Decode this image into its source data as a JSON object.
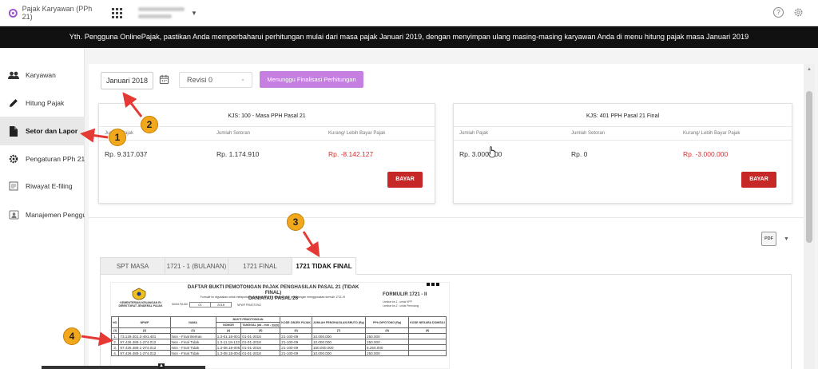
{
  "app": {
    "title": "Pajak Karyawan (PPh 21)"
  },
  "banner": {
    "text": "Yth. Pengguna OnlinePajak, pastikan Anda memperbaharui perhitungan mulai dari masa pajak Januari 2019, dengan menyimpan ulang masing-masing karyawan Anda di menu hitung pajak masa Januari 2019"
  },
  "sidebar": {
    "items": [
      {
        "label": "Karyawan",
        "icon": "people-icon"
      },
      {
        "label": "Hitung Pajak",
        "icon": "pencil-icon"
      },
      {
        "label": "Setor dan Lapor",
        "icon": "document-icon"
      },
      {
        "label": "Pengaturan PPh 21",
        "icon": "gear-icon"
      },
      {
        "label": "Riwayat E-filing",
        "icon": "history-icon"
      },
      {
        "label": "Manajemen Pengguna",
        "icon": "users-icon"
      }
    ]
  },
  "toolbar": {
    "month": "Januari 2018",
    "revision": "Revisi 0",
    "status_button": "Menunggu Finalisasi Perhitungan"
  },
  "cards": [
    {
      "title": "KJS: 100 - Masa PPH Pasal 21",
      "col1": "Jumlah Pajak",
      "col2": "Jumlah Setoran",
      "col3": "Kurang/ Lebih Bayar Pajak",
      "val1": "Rp. 9.317.037",
      "val2": "Rp. 1.174.910",
      "val3": "Rp. -8.142.127",
      "button": "BAYAR"
    },
    {
      "title": "KJS: 401 PPH Pasal 21 Final",
      "col1": "Jumlah Pajak",
      "col2": "Jumlah Setoran",
      "col3": "Kurang/ Lebih Bayar Pajak",
      "val1": "Rp. 3.000.000",
      "val2": "Rp. 0",
      "val3": "Rp. -3.000.000",
      "button": "BAYAR"
    }
  ],
  "export": {
    "label": "PDF"
  },
  "tabs": [
    {
      "label": "SPT MASA"
    },
    {
      "label": "1721 - 1 (BULANAN)"
    },
    {
      "label": "1721 FINAL"
    },
    {
      "label": "1721 TIDAK FINAL"
    }
  ],
  "document": {
    "agency": "KEMENTERIAN KEUANGAN RI DIREKTORAT JENDERAL PAJAK",
    "title_line1": "DAFTAR BUKTI PEMOTONGAN PAJAK PENGHASILAN PASAL 21 (TIDAK FINAL)",
    "title_line2": "DAN/ATAU PASAL 26",
    "subtitle": "Formulir ini digunakan untuk melaporkan pemotongan PPh dengan bukti pemotongan menggunakan formulir 1721-VI",
    "form_code": "FORMULIR 1721 - II",
    "masa_pajak_label": "MASA PAJAK",
    "masa_pajak_month": "01",
    "masa_pajak_year": "2018",
    "npwp_label": "NPWP PEMOTONG",
    "lampiran1": "Lembar ke-1 : untuk KPP",
    "lampiran2": "Lembar ke-2 : untuk Pemotong",
    "headers": [
      "NO.",
      "NPWP",
      "NAMA",
      "BUKTI PEMOTONGAN",
      "KODE OBJEK PAJAK",
      "JUMLAH PENGHASILAN BRUTO (Rp)",
      "PPh DIPOTONG (Rp)",
      "KODE NEGARA DOMISILI"
    ],
    "subheaders": [
      "NOMOR",
      "TANGGAL (dd - mm - yyyy)"
    ],
    "colnums": [
      "(1)",
      "(2)",
      "(3)",
      "(4)",
      "(5)",
      "(6)",
      "(7)",
      "(8)",
      "(9)"
    ],
    "rows": [
      {
        "no": "1.",
        "npwp": "73.129.401.3-491.401",
        "nama": "Non - Final Berkas",
        "nomor": "1.3-01.18-001",
        "tanggal": "01-01-2018",
        "kode": "21-100-09",
        "bruto": "10.000.000",
        "pph": "250.000"
      },
      {
        "no": "2.",
        "npwp": "97.426.489.1-274.012",
        "nama": "Non - Final Tidak",
        "nomor": "1.3-11.18-123",
        "tanggal": "01-01-2018",
        "kode": "21-100-09",
        "bruto": "10.000.000",
        "pph": "250.000"
      },
      {
        "no": "3.",
        "npwp": "97.426.489.1-274.012",
        "nama": "Non - Final Tidak",
        "nomor": "1.3-08.18-005",
        "tanggal": "01-01-2018",
        "kode": "21-100-09",
        "bruto": "150.000.000",
        "pph": "6.250.000"
      },
      {
        "no": "4.",
        "npwp": "97.426.489.1-274.012",
        "nama": "Non - Final Tidak",
        "nomor": "1.3-08.18-004",
        "tanggal": "01-01-2018",
        "kode": "21-100-09",
        "bruto": "10.000.000",
        "pph": "250.000"
      }
    ]
  },
  "callouts": [
    "1",
    "2",
    "3",
    "4"
  ],
  "colors": {
    "banner_bg": "#111111",
    "status_button": "#c57fe0",
    "bayar_button": "#c62828",
    "negative_value": "#d32f2f",
    "callout": "#f2a81d",
    "arrow": "#e53935"
  }
}
